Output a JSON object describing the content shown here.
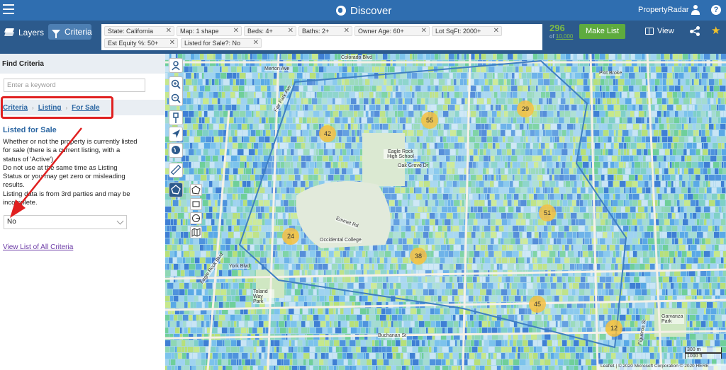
{
  "topbar": {
    "title": "Discover",
    "brand": "PropertyRadar",
    "help": "?"
  },
  "toolbar": {
    "layers_label": "Layers",
    "criteria_label": "Criteria",
    "chips": [
      "State: California",
      "Map: 1 shape",
      "Beds: 4+",
      "Baths: 2+",
      "Owner Age: 60+",
      "Lot SqFt: 2000+",
      "Est Equity %: 50+",
      "Listed for Sale?: No"
    ],
    "chip_close": "✕",
    "count": "296",
    "count_of_prefix": "of",
    "count_total": "10,000",
    "make_list_label": "Make List",
    "view_label": "View",
    "star_glyph": "★"
  },
  "sidebar": {
    "title": "Find Criteria",
    "keyword_placeholder": "Enter a keyword",
    "breadcrumbs": [
      "Criteria",
      "Listing",
      "For Sale"
    ],
    "breadcrumb_sep": "›",
    "section_title": "Listed for Sale",
    "description": [
      "Whether or not the property is currently listed for sale (there is a current listing, with a status of 'Active').",
      "Do not use at the same time as Listing Status or you may get zero or misleading results.",
      "Listing data is from 3rd parties and may be incomplete."
    ],
    "select_value": "No",
    "view_all_link": "View List of All Criteria"
  },
  "map": {
    "clusters": [
      "42",
      "55",
      "29",
      "51",
      "24",
      "38",
      "45",
      "12"
    ],
    "labels": [
      "Colorado Blvd",
      "Merton Ave",
      "Fair Park Ave",
      "Eagle Rock High School",
      "Oak Grove Dr",
      "Occidental College",
      "York Blvd",
      "Toland Way Park",
      "Buchanan St",
      "Garvanza Park",
      "Eagle Rock Blvd",
      "Emmet Rd",
      "Figueroa St",
      "Plot Broke"
    ],
    "scale_metric": "300 m",
    "scale_imperial": "1000 ft",
    "attribution": "Leaflet | © 2020 Microsoft Corporation © 2020 HERE"
  },
  "colors": {
    "topbar": "#2f6eb0",
    "toolbar": "#2c5a8c",
    "make_list": "#5eab3e",
    "count": "#7dbb45",
    "link": "#2c67a3",
    "highlight": "#e02020",
    "cluster": "#f6bf40"
  }
}
